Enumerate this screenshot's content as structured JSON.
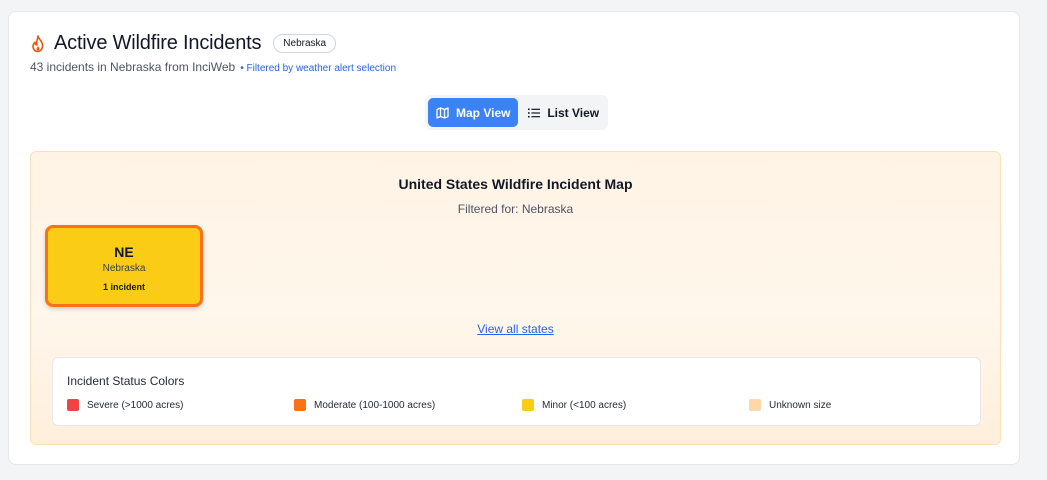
{
  "header": {
    "title": "Active Wildfire Incidents",
    "state_badge": "Nebraska",
    "subtitle": "43 incidents in Nebraska from InciWeb",
    "filter_note": "• Filtered by weather alert selection",
    "icon": "flame-icon"
  },
  "view_toggle": {
    "map_label": "Map View",
    "list_label": "List View",
    "active": "map",
    "map_icon": "map-icon",
    "list_icon": "list-icon"
  },
  "map": {
    "title": "United States Wildfire Incident Map",
    "filtered_for": "Filtered for: Nebraska",
    "states": [
      {
        "code": "NE",
        "name": "Nebraska",
        "count_label": "1 incident",
        "fill": "#facc15",
        "border": "#f97316"
      }
    ],
    "view_all_link": "View all states"
  },
  "legend": {
    "title": "Incident Status Colors",
    "items": [
      {
        "label": "Severe (>1000 acres)",
        "color": "#ef4444"
      },
      {
        "label": "Moderate (100-1000 acres)",
        "color": "#f97316"
      },
      {
        "label": "Minor (<100 acres)",
        "color": "#facc15"
      },
      {
        "label": "Unknown size",
        "color": "#fed7aa"
      }
    ]
  },
  "colors": {
    "accent": "#3b82f6",
    "link": "#2563eb"
  }
}
